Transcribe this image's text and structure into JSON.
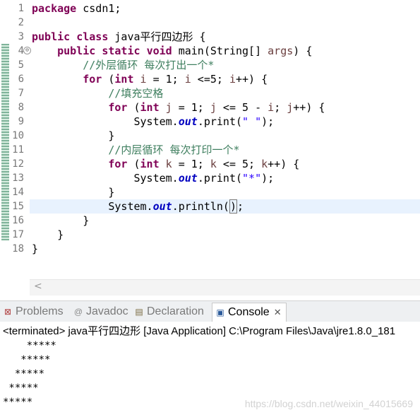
{
  "editor": {
    "line_numbers": [
      "1",
      "2",
      "3",
      "4",
      "5",
      "6",
      "7",
      "8",
      "9",
      "10",
      "11",
      "12",
      "13",
      "14",
      "15",
      "16",
      "17",
      "18"
    ],
    "lines": [
      [
        {
          "t": "package",
          "c": "kw"
        },
        {
          "t": " csdn1;"
        }
      ],
      [],
      [
        {
          "t": "public",
          "c": "kw"
        },
        {
          "t": " "
        },
        {
          "t": "class",
          "c": "kw"
        },
        {
          "t": " java平行四边形 {"
        }
      ],
      [
        {
          "t": "    "
        },
        {
          "t": "public",
          "c": "kw"
        },
        {
          "t": " "
        },
        {
          "t": "static",
          "c": "kw"
        },
        {
          "t": " "
        },
        {
          "t": "void",
          "c": "kw"
        },
        {
          "t": " main(String[] "
        },
        {
          "t": "args",
          "c": "var"
        },
        {
          "t": ") {"
        }
      ],
      [
        {
          "t": "        "
        },
        {
          "t": "//外层循环 每次打出一个*",
          "c": "cm"
        }
      ],
      [
        {
          "t": "        "
        },
        {
          "t": "for",
          "c": "kw"
        },
        {
          "t": " ("
        },
        {
          "t": "int",
          "c": "kw"
        },
        {
          "t": " "
        },
        {
          "t": "i",
          "c": "var"
        },
        {
          "t": " = 1; "
        },
        {
          "t": "i",
          "c": "var"
        },
        {
          "t": " <=5; "
        },
        {
          "t": "i",
          "c": "var"
        },
        {
          "t": "++) {"
        }
      ],
      [
        {
          "t": "            "
        },
        {
          "t": "//填充空格",
          "c": "cm"
        }
      ],
      [
        {
          "t": "            "
        },
        {
          "t": "for",
          "c": "kw"
        },
        {
          "t": " ("
        },
        {
          "t": "int",
          "c": "kw"
        },
        {
          "t": " "
        },
        {
          "t": "j",
          "c": "var"
        },
        {
          "t": " = 1; "
        },
        {
          "t": "j",
          "c": "var"
        },
        {
          "t": " <= 5 - "
        },
        {
          "t": "i",
          "c": "var"
        },
        {
          "t": "; "
        },
        {
          "t": "j",
          "c": "var"
        },
        {
          "t": "++) {"
        }
      ],
      [
        {
          "t": "                System."
        },
        {
          "t": "out",
          "c": "fld"
        },
        {
          "t": ".print("
        },
        {
          "t": "\" \"",
          "c": "st"
        },
        {
          "t": ");"
        }
      ],
      [
        {
          "t": "            }"
        }
      ],
      [
        {
          "t": "            "
        },
        {
          "t": "//内层循环 每次打印一个*",
          "c": "cm"
        }
      ],
      [
        {
          "t": "            "
        },
        {
          "t": "for",
          "c": "kw"
        },
        {
          "t": " ("
        },
        {
          "t": "int",
          "c": "kw"
        },
        {
          "t": " "
        },
        {
          "t": "k",
          "c": "var"
        },
        {
          "t": " = 1; "
        },
        {
          "t": "k",
          "c": "var"
        },
        {
          "t": " <= 5; "
        },
        {
          "t": "k",
          "c": "var"
        },
        {
          "t": "++) {"
        }
      ],
      [
        {
          "t": "                System."
        },
        {
          "t": "out",
          "c": "fld"
        },
        {
          "t": ".print("
        },
        {
          "t": "\"*\"",
          "c": "st"
        },
        {
          "t": ");"
        }
      ],
      [
        {
          "t": "            }"
        }
      ],
      [
        {
          "t": "            System."
        },
        {
          "t": "out",
          "c": "fld"
        },
        {
          "t": ".println("
        },
        {
          "t": ")",
          "c": "caret-box"
        },
        {
          "t": ";"
        }
      ],
      [
        {
          "t": "        }"
        }
      ],
      [
        {
          "t": "    }"
        }
      ],
      [
        {
          "t": "}"
        }
      ]
    ],
    "fold_marker": "⊖",
    "scroll_arrow": "<"
  },
  "tabs": [
    {
      "label": "Problems",
      "icon": "problems-icon",
      "glyph": "⊠",
      "color": "#b04040",
      "active": false
    },
    {
      "label": "Javadoc",
      "icon": "javadoc-icon",
      "glyph": "@",
      "color": "#8a8a8a",
      "active": false
    },
    {
      "label": "Declaration",
      "icon": "declaration-icon",
      "glyph": "▤",
      "color": "#7a6a40",
      "active": false
    },
    {
      "label": "Console",
      "icon": "console-icon",
      "glyph": "▣",
      "color": "#2a5a9a",
      "active": true
    }
  ],
  "console": {
    "status": "<terminated> java平行四边形 [Java Application] C:\\Program Files\\Java\\jre1.8.0_181",
    "output": [
      "    *****",
      "   *****",
      "  *****",
      " *****",
      "*****"
    ],
    "close_glyph": "✕"
  },
  "watermark": "https://blog.csdn.net/weixin_44015669"
}
